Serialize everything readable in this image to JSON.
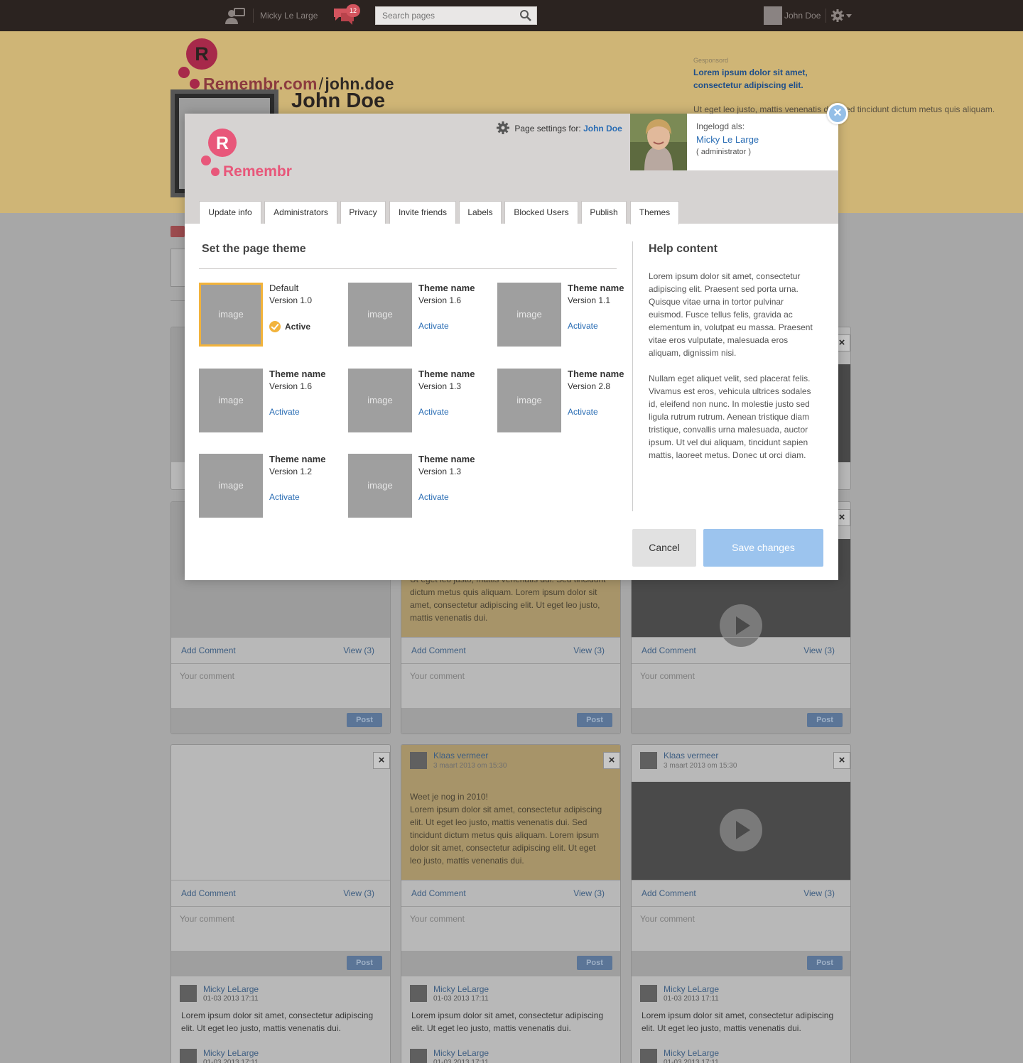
{
  "topbar": {
    "user_name": "Micky Le Large",
    "notifications_count": "12",
    "search_placeholder": "Search pages",
    "account_name": "John Doe"
  },
  "header": {
    "site_domain": "Remembr.com",
    "site_slash": "/",
    "site_user": "john.doe",
    "profile_name": "John Doe",
    "ad": {
      "label": "Gesponsord",
      "title": "Lorem ipsum dolor sit amet, consectetur adipiscing elit.",
      "body": "Ut eget leo justo, mattis venenatis dui. Sed tincidunt dictum metus quis aliquam."
    }
  },
  "modal": {
    "brand": "Remembr",
    "settings_label": "Page settings for:",
    "settings_name": "John Doe",
    "login": {
      "label": "Ingelogd als:",
      "name": "Micky Le Large",
      "role": "( administrator )"
    },
    "close_label": "×",
    "tabs": [
      "Update info",
      "Administrators",
      "Privacy",
      "Invite friends",
      "Labels",
      "Blocked Users",
      "Publish",
      "Themes"
    ],
    "active_tab": "Themes",
    "pane_title": "Set the page theme",
    "image_placeholder": "image",
    "themes": [
      {
        "name": "Default",
        "version": "Version 1.0",
        "status": "Active"
      },
      {
        "name": "Theme name",
        "version": "Version 1.6",
        "status": "Activate"
      },
      {
        "name": "Theme name",
        "version": "Version 1.1",
        "status": "Activate"
      },
      {
        "name": "Theme name",
        "version": "Version 1.6",
        "status": "Activate"
      },
      {
        "name": "Theme name",
        "version": "Version 1.3",
        "status": "Activate"
      },
      {
        "name": "Theme name",
        "version": "Version 2.8",
        "status": "Activate"
      },
      {
        "name": "Theme name",
        "version": "Version 1.2",
        "status": "Activate"
      },
      {
        "name": "Theme name",
        "version": "Version 1.3",
        "status": "Activate"
      }
    ],
    "help": {
      "title": "Help content",
      "p1": "Lorem ipsum dolor sit amet, consectetur adipiscing elit. Praesent sed porta urna. Quisque vitae urna in tortor pulvinar euismod. Fusce tellus felis, gravida ac elementum in, volutpat eu massa. Praesent vitae eros vulputate, malesuada eros aliquam, dignissim nisi.",
      "p2": "Nullam eget aliquet velit, sed placerat felis. Vivamus est eros, vehicula ultrices sodales id, eleifend non nunc. In molestie justo sed ligula rutrum rutrum. Aenean tristique diam tristique, convallis urna malesuada, auctor ipsum. Ut vel dui aliquam, tincidunt sapien mattis, laoreet metus. Donec ut orci diam."
    },
    "cancel_label": "Cancel",
    "save_label": "Save changes"
  },
  "feed": {
    "add_comment": "Add Comment",
    "view": "View (3)",
    "comment_placeholder": "Your comment",
    "post_label": "Post",
    "close_label": "×",
    "author": "Klaas vermeer",
    "date": "3 maart 2013 om 15:30",
    "post_text_partial": "Ut eget leo justo, mattis venenatis dui. Sed tincidunt dictum metus quis aliquam. Lorem ipsum dolor sit amet, consectetur adipiscing elit. Ut eget leo justo, mattis venenatis dui.",
    "post_text_full": "Weet je nog in 2010!\nLorem ipsum dolor sit amet, consectetur adipiscing elit. Ut eget leo justo, mattis venenatis dui. Sed tincidunt dictum metus quis aliquam. Lorem ipsum dolor sit amet, consectetur adipiscing elit. Ut eget leo justo, mattis venenatis dui.",
    "comment_author": "Micky LeLarge",
    "comment_date": "01-03 2013 17:11",
    "comment_text": "Lorem ipsum dolor sit amet, consectetur adipiscing elit. Ut eget leo justo, mattis venenatis dui."
  },
  "colors": {
    "topbar": "#2b2320",
    "header": "#cfb576",
    "link": "#2a6db4",
    "accent_pink": "#e8577a",
    "active_theme": "#f2b33b",
    "save_button": "#9cc4ee",
    "close_button": "#95bfe7"
  },
  "icons": {
    "people": "people-icon",
    "chat": "chat-icon",
    "search": "search-icon",
    "gear": "gear-icon",
    "close": "close-icon",
    "check": "check-icon",
    "play": "play-icon"
  }
}
